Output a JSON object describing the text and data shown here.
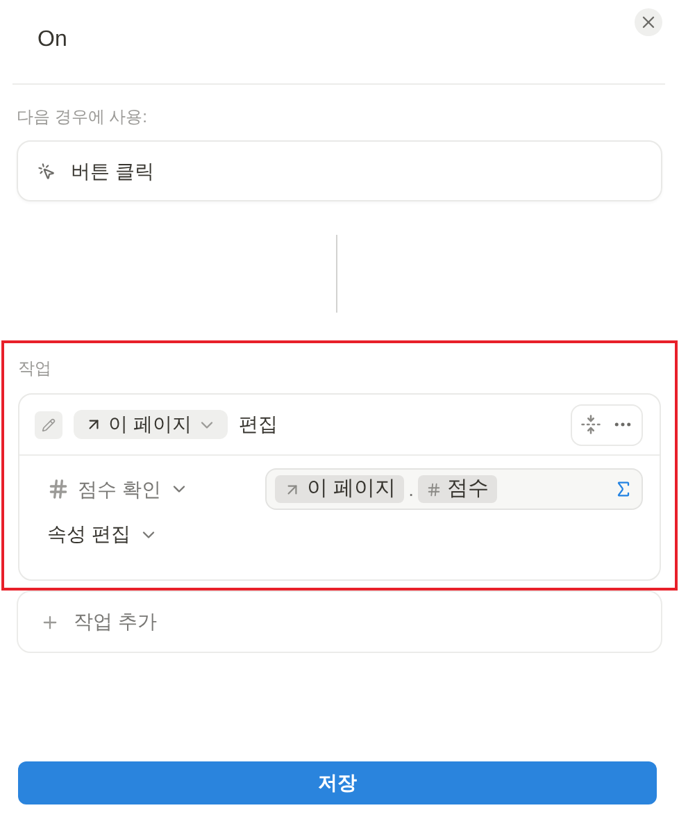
{
  "title": "On",
  "trigger": {
    "label": "다음 경우에 사용:",
    "value": "버튼 클릭"
  },
  "actions_section": {
    "label": "작업",
    "highlighted": true,
    "action": {
      "target": "이 페이지",
      "verb": "편집",
      "property": {
        "name": "점수 확인",
        "formula": [
          {
            "kind": "page",
            "text": "이 페이지"
          },
          {
            "kind": "dot",
            "text": "."
          },
          {
            "kind": "number",
            "text": "점수"
          }
        ]
      },
      "edit_property": "속성 편집"
    }
  },
  "add_action": "작업 추가",
  "save_button": "저장"
}
